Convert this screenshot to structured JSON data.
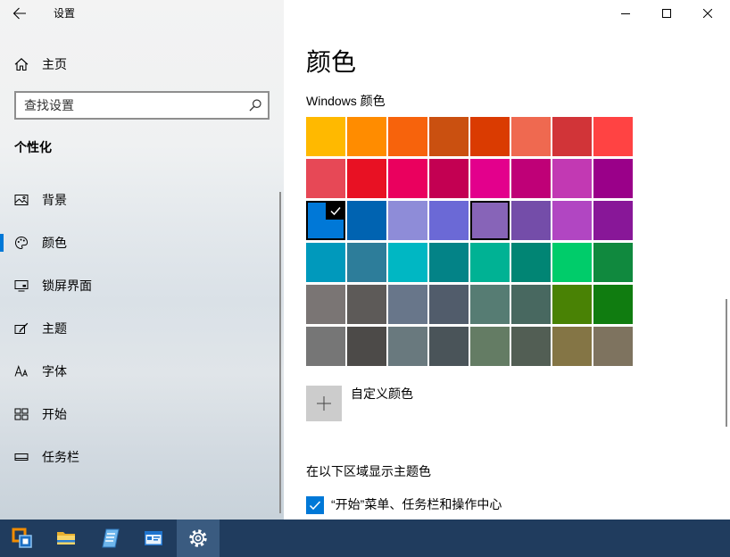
{
  "window": {
    "controls": [
      {
        "name": "minimize",
        "icon": "minimize-icon"
      },
      {
        "name": "maximize",
        "icon": "maximize-icon"
      },
      {
        "name": "close",
        "icon": "close-icon"
      }
    ]
  },
  "sidebar": {
    "back_icon": "back-arrow-icon",
    "app_title": "设置",
    "home": {
      "label": "主页",
      "icon": "home-icon"
    },
    "search": {
      "placeholder": "查找设置",
      "value": "",
      "icon": "search-icon"
    },
    "section_title": "个性化",
    "items": [
      {
        "label": "背景",
        "icon": "picture-icon",
        "selected": false
      },
      {
        "label": "颜色",
        "icon": "palette-icon",
        "selected": true
      },
      {
        "label": "锁屏界面",
        "icon": "lock-screen-icon",
        "selected": false
      },
      {
        "label": "主题",
        "icon": "theme-brush-icon",
        "selected": false
      },
      {
        "label": "字体",
        "icon": "font-icon",
        "selected": false
      },
      {
        "label": "开始",
        "icon": "start-grid-icon",
        "selected": false
      },
      {
        "label": "任务栏",
        "icon": "taskbar-icon",
        "selected": false
      }
    ]
  },
  "main": {
    "page_title": "颜色",
    "windows_colors_label": "Windows 颜色",
    "swatches": [
      [
        "#FFB900",
        "#FF8C00",
        "#F7630C",
        "#CA5010",
        "#DA3B01",
        "#EF6950",
        "#D13438",
        "#FF4343"
      ],
      [
        "#E74856",
        "#E81123",
        "#EA005E",
        "#C30052",
        "#E3008C",
        "#BF0077",
        "#C239B3",
        "#9A0089"
      ],
      [
        "#0078D7",
        "#0063B1",
        "#8E8CD8",
        "#6B69D6",
        "#8764B8",
        "#744DA9",
        "#B146C2",
        "#881798"
      ],
      [
        "#0099BC",
        "#2D7D9A",
        "#00B7C3",
        "#038387",
        "#00B294",
        "#018574",
        "#00CC6A",
        "#10893E"
      ],
      [
        "#7A7574",
        "#5D5A58",
        "#68768A",
        "#515C6B",
        "#567C73",
        "#486860",
        "#498205",
        "#107C10"
      ],
      [
        "#767676",
        "#4C4A48",
        "#69797E",
        "#4A5459",
        "#647C64",
        "#525E54",
        "#847545",
        "#7E735F"
      ]
    ],
    "selected_swatch": "#0078D7",
    "hovered_swatch": "#8764B8",
    "custom_color": {
      "label": "自定义颜色",
      "icon": "plus-icon"
    },
    "accent_surfaces_label": "在以下区域显示主题色",
    "accent_surfaces_option": {
      "label": "“开始”菜单、任务栏和操作中心",
      "checked": true
    }
  },
  "taskbar": {
    "apps": [
      {
        "icon": "vmware-workstation-icon",
        "active": false
      },
      {
        "icon": "file-explorer-icon",
        "active": false
      },
      {
        "icon": "notepad-icon",
        "active": false
      },
      {
        "icon": "app-window-icon",
        "active": false
      },
      {
        "icon": "settings-gear-icon",
        "active": true
      }
    ]
  },
  "colors": {
    "accent": "#0078D7",
    "taskbar": "#203C5E",
    "taskbar_active": "#3A5B80"
  }
}
